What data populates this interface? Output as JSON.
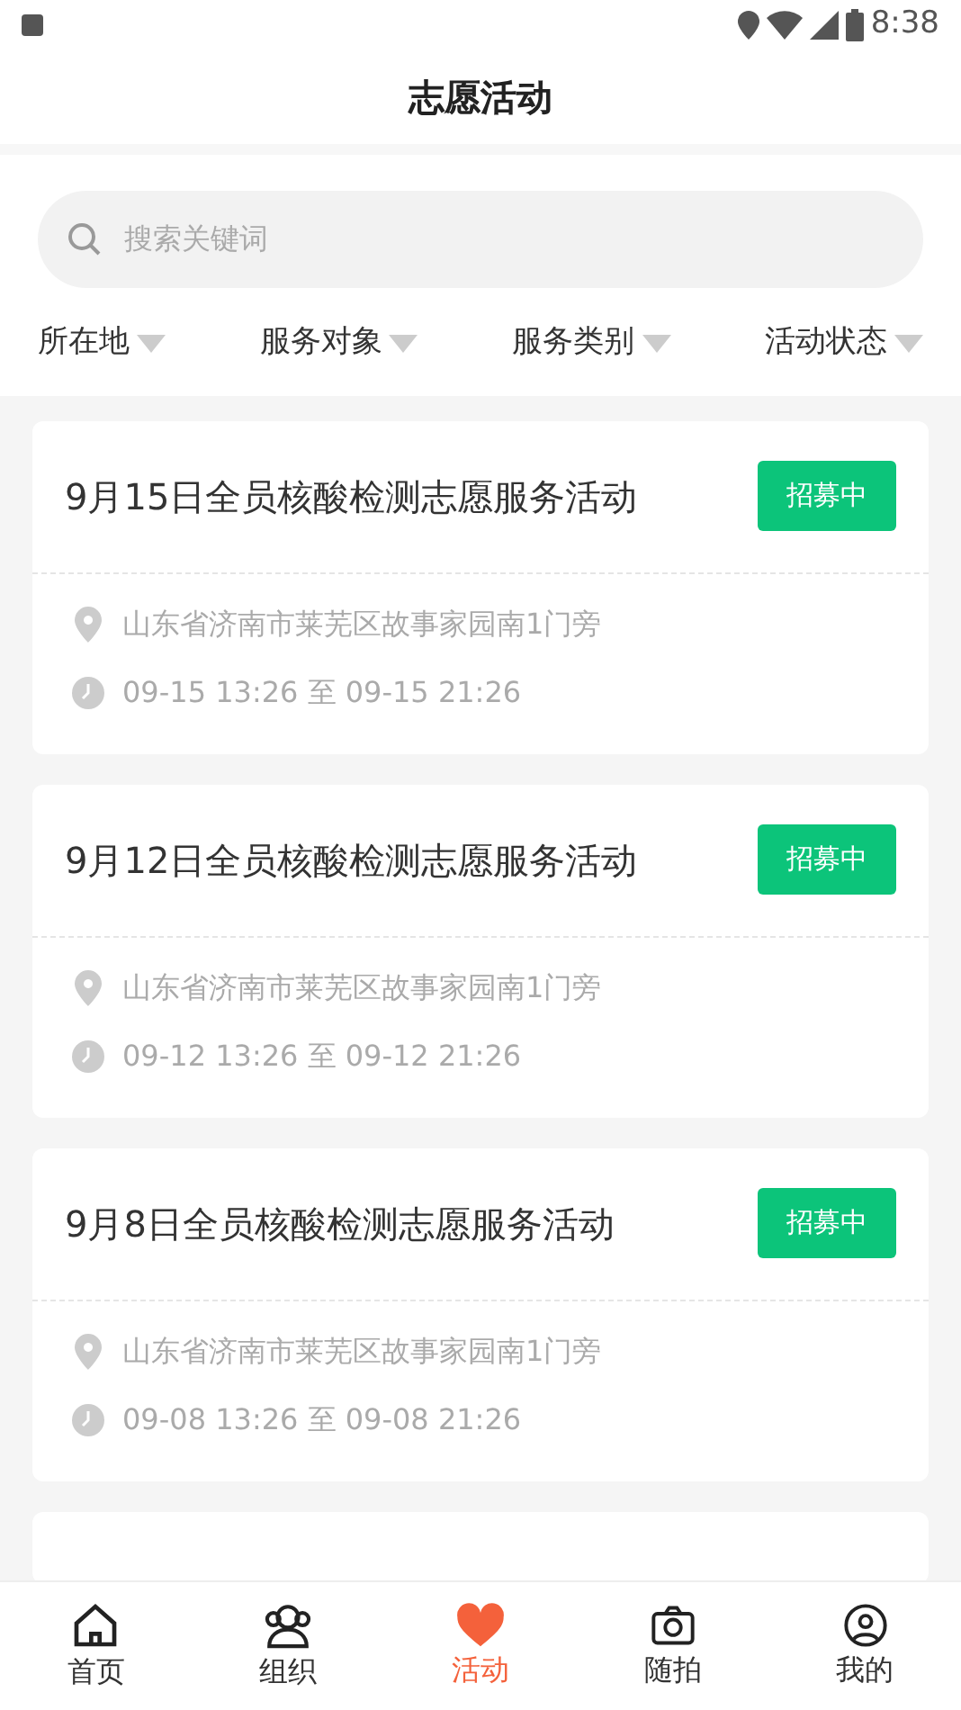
{
  "status_bar": {
    "time": "8:38"
  },
  "header": {
    "title": "志愿活动"
  },
  "search": {
    "placeholder": "搜索关键词"
  },
  "filters": [
    {
      "label": "所在地"
    },
    {
      "label": "服务对象"
    },
    {
      "label": "服务类别"
    },
    {
      "label": "活动状态"
    }
  ],
  "activities": [
    {
      "title": "9月15日全员核酸检测志愿服务活动",
      "status": "招募中",
      "location": "山东省济南市莱芜区故事家园南1门旁",
      "time": "09-15 13:26 至 09-15 21:26"
    },
    {
      "title": "9月12日全员核酸检测志愿服务活动",
      "status": "招募中",
      "location": "山东省济南市莱芜区故事家园南1门旁",
      "time": "09-12 13:26 至 09-12 21:26"
    },
    {
      "title": "9月8日全员核酸检测志愿服务活动",
      "status": "招募中",
      "location": "山东省济南市莱芜区故事家园南1门旁",
      "time": "09-08 13:26 至 09-08 21:26"
    }
  ],
  "bottom_nav": [
    {
      "label": "首页",
      "kind": "home",
      "selected": false
    },
    {
      "label": "组织",
      "kind": "people",
      "selected": false
    },
    {
      "label": "活动",
      "kind": "heart",
      "selected": true
    },
    {
      "label": "随拍",
      "kind": "camera",
      "selected": false
    },
    {
      "label": "我的",
      "kind": "user",
      "selected": false
    }
  ]
}
